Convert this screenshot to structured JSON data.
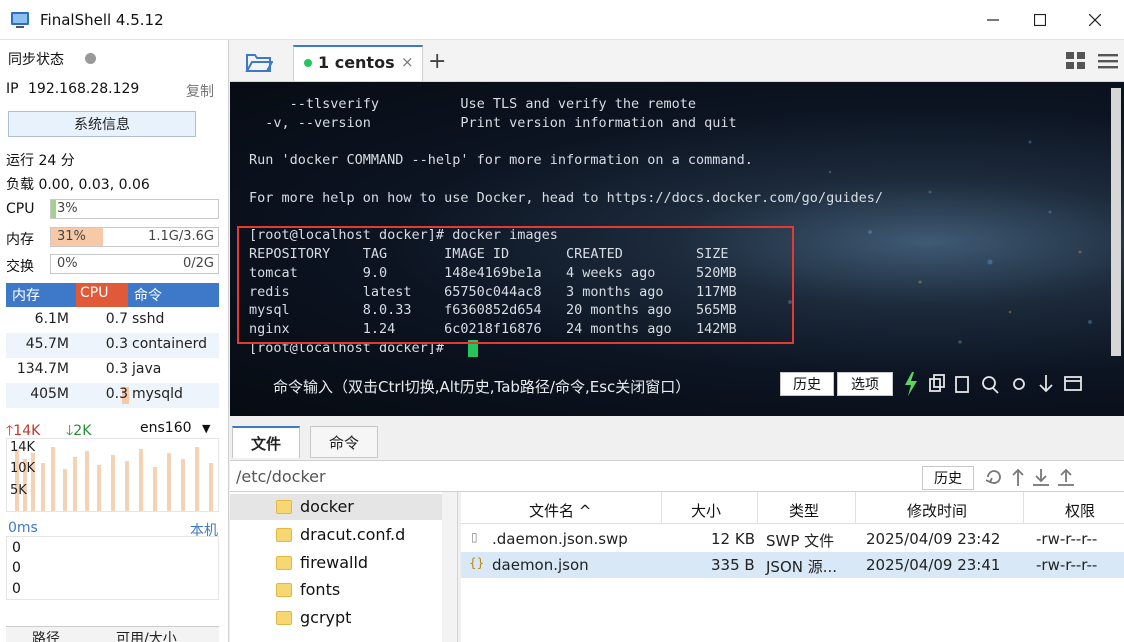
{
  "app": {
    "title": "FinalShell 4.5.12"
  },
  "left": {
    "sync_label": "同步状态",
    "ip_label": "IP",
    "ip_value": "192.168.28.129",
    "copy_label": "复制",
    "sysinfo_button": "系统信息",
    "uptime": "运行 24 分",
    "load": "负载 0.00, 0.03, 0.06",
    "cpu": {
      "label": "CPU",
      "percent": "3%",
      "fraction": 0.03
    },
    "memory": {
      "label": "内存",
      "percent": "31%",
      "detail": "1.1G/3.6G",
      "fraction": 0.31
    },
    "swap": {
      "label": "交换",
      "percent": "0%",
      "detail": "0/2G",
      "fraction": 0
    },
    "proc_headers": [
      "内存",
      "CPU",
      "命令"
    ],
    "processes": [
      {
        "mem": "6.1M",
        "cpu": "0.7",
        "cmd": "sshd"
      },
      {
        "mem": "45.7M",
        "cpu": "0.3",
        "cmd": "containerd"
      },
      {
        "mem": "134.7M",
        "cpu": "0.3",
        "cmd": "java"
      },
      {
        "mem": "405M",
        "cpu": "0.3",
        "cmd": "mysqld"
      }
    ],
    "net": {
      "up": "14K",
      "down": "2K",
      "iface": "ens160",
      "ticks": [
        "14K",
        "10K",
        "5K"
      ]
    },
    "ping": {
      "label": "0ms",
      "host": "本机",
      "values": [
        "0",
        "0",
        "0"
      ]
    },
    "bottom_tabs": [
      "路径",
      "可用/大小"
    ]
  },
  "tabs": {
    "session": "1 centos"
  },
  "terminal": {
    "lines": [
      "     --tlsverify          Use TLS and verify the remote",
      "  -v, --version           Print version information and quit",
      "",
      "Run 'docker COMMAND --help' for more information on a command.",
      "",
      "For more help on how to use Docker, head to https://docs.docker.com/go/guides/",
      "",
      "[root@localhost docker]# docker images",
      "REPOSITORY    TAG       IMAGE ID       CREATED         SIZE",
      "tomcat        9.0       148e4169be1a   4 weeks ago     520MB",
      "redis         latest    65750c044ac8   3 months ago    117MB",
      "mysql         8.0.33    f6360852d654   20 months ago   565MB",
      "nginx         1.24      6c0218f16876   24 months ago   142MB",
      "[root@localhost docker]# "
    ],
    "cmd_hint": "命令输入（双击Ctrl切换,Alt历史,Tab路径/命令,Esc关闭窗口）",
    "history_btn": "历史",
    "options_btn": "选项"
  },
  "files": {
    "tab_files": "文件",
    "tab_commands": "命令",
    "path": "/etc/docker",
    "history_btn": "历史",
    "tree": [
      "docker",
      "dracut.conf.d",
      "firewalld",
      "fonts",
      "gcrypt"
    ],
    "headers": {
      "name": "文件名 ^",
      "size": "大小",
      "type": "类型",
      "mtime": "修改时间",
      "perm": "权限"
    },
    "rows": [
      {
        "name": ".daemon.json.swp",
        "size": "12 KB",
        "type": "SWP 文件",
        "mtime": "2025/04/09 23:42",
        "perm": "-rw-r--r--"
      },
      {
        "name": "daemon.json",
        "size": "335 B",
        "type": "JSON 源...",
        "mtime": "2025/04/09 23:41",
        "perm": "-rw-r--r--"
      }
    ]
  },
  "colors": {
    "accent": "#3d79c8",
    "cpu_bar": "#9fd48a",
    "mem_bar": "#f7c9a7",
    "red_box": "#e23b31",
    "green_cursor": "#22c55e"
  }
}
